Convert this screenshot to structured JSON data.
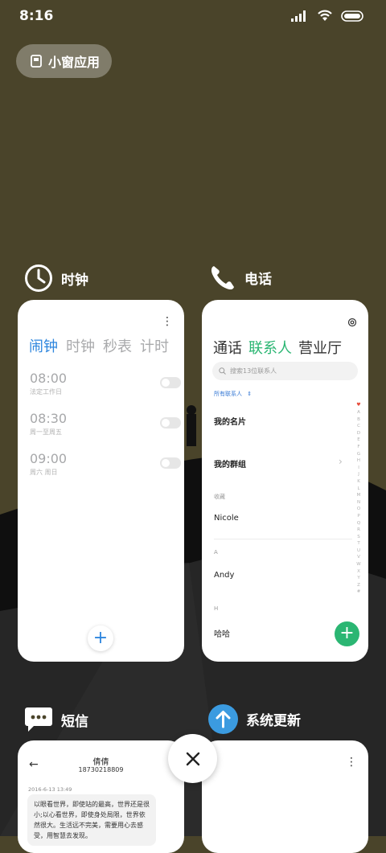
{
  "status_bar": {
    "time": "8:16"
  },
  "mini_window": {
    "label": "小窗应用"
  },
  "apps": [
    {
      "name": "时钟",
      "tabs": [
        "闹钟",
        "时钟",
        "秒表",
        "计时"
      ],
      "alarms": [
        {
          "time": "08:00",
          "label": "法定工作日"
        },
        {
          "time": "08:30",
          "label": "周一至周五"
        },
        {
          "time": "09:00",
          "label": "周六 周日"
        }
      ]
    },
    {
      "name": "电话",
      "tabs": [
        "通话",
        "联系人",
        "营业厅"
      ],
      "search_placeholder": "搜索13位联系人",
      "filter_label": "所有联系人",
      "my_card": "我的名片",
      "my_groups": "我的群组",
      "favorites_label": "收藏",
      "contacts": [
        {
          "section": "",
          "name": "Nicole"
        },
        {
          "section": "A",
          "name": "Andy"
        },
        {
          "section": "H",
          "name": "哈哈"
        }
      ],
      "alpha_index": "A\nB\nC\nD\nE\nF\nG\nH\nI\nJ\nK\nL\nM\nN\nO\nP\nQ\nR\nS\nT\nU\nV\nW\nX\nY\nZ\n#"
    },
    {
      "name": "短信",
      "contact_name": "倩倩",
      "contact_number": "18730218809",
      "date": "2016-6-13 13:49",
      "message": "以眼看世界，即使站的最高，世界还是很小;以心看世界，即使身处局限，世界依然很大。生活远不完美，需要用心去感受，用智慧去发现。"
    },
    {
      "name": "系统更新"
    }
  ],
  "colors": {
    "wallpaper": "#4a442a",
    "clock_accent": "#2e86de",
    "phone_accent": "#2bb673",
    "update_icon": "#3b9be0"
  },
  "icons": [
    "clock-icon",
    "phone-icon",
    "sms-icon",
    "update-icon",
    "close-icon",
    "wifi-icon",
    "signal-icon",
    "battery-icon"
  ]
}
